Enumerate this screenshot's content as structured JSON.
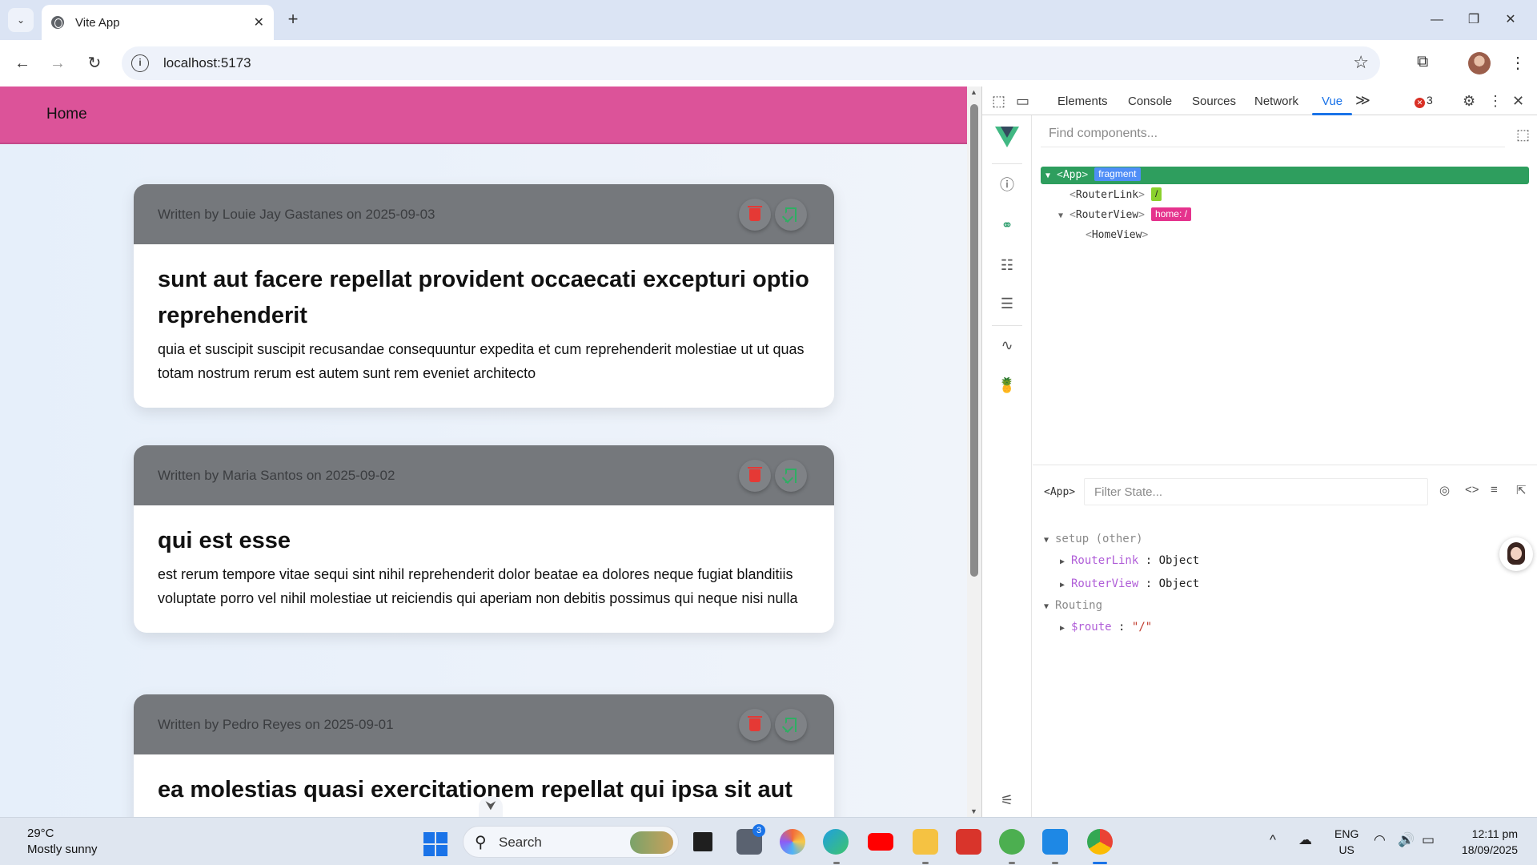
{
  "browser": {
    "tab_title": "Vite App",
    "tab_close": "✕",
    "new_tab": "+",
    "tab_search": "⌄",
    "window": {
      "minimize": "—",
      "maximize": "❐",
      "close": "✕"
    },
    "nav": {
      "back": "←",
      "forward": "→",
      "reload": "↻"
    },
    "site_info": "i",
    "url": "localhost:5173",
    "bookmark_star": "☆",
    "extensions": "⧉",
    "menu": "⋮"
  },
  "app": {
    "nav_home": "Home",
    "posts": [
      {
        "byline": "Written by Louie Jay Gastanes on 2025-09-03",
        "title": "sunt aut facere repellat provident occaecati excepturi optio reprehenderit",
        "body": "quia et suscipit suscipit recusandae consequuntur expedita et cum reprehenderit molestiae ut ut quas totam nostrum rerum est autem sunt rem eveniet architecto"
      },
      {
        "byline": "Written by Maria Santos on 2025-09-02",
        "title": "qui est esse",
        "body": "est rerum tempore vitae sequi sint nihil reprehenderit dolor beatae ea dolores neque fugiat blanditiis voluptate porro vel nihil molestiae ut reiciendis qui aperiam non debitis possimus qui neque nisi nulla"
      },
      {
        "byline": "Written by Pedro Reyes on 2025-09-01",
        "title": "ea molestias quasi exercitationem repellat qui ipsa sit aut",
        "body": ""
      }
    ],
    "scroll_hint": "⮟"
  },
  "devtools": {
    "tabs": [
      "Elements",
      "Console",
      "Sources",
      "Network",
      "Vue"
    ],
    "active_tab": "Vue",
    "more_tabs": "≫",
    "error_count": "3",
    "error_icon": "✕",
    "settings": "⚙",
    "menu": "⋮",
    "close": "✕",
    "inspect_icon": "⬚",
    "device_icon": "▭",
    "rail": {
      "info": "ⓘ",
      "components": "⚭",
      "tree": "☷",
      "timeline": "☰",
      "routes": "∿",
      "pinia": "🍍",
      "settings": "⚟"
    },
    "find_placeholder": "Find components...",
    "select_tool": "⬚",
    "tree": {
      "app": "App",
      "app_chip": "fragment",
      "router_link": "RouterLink",
      "router_link_chip": "/",
      "router_view": "RouterView",
      "router_view_chip": "home: /",
      "home_view": "HomeView",
      "lt": "<",
      "gt": ">"
    },
    "state": {
      "component_name": "<App>",
      "filter_placeholder": "Filter State...",
      "tools": [
        "◎",
        "<>",
        "≡",
        "⇱"
      ],
      "setup_label": "setup (other)",
      "router_link_key": "RouterLink",
      "router_view_key": "RouterView",
      "object_label": "Object",
      "routing_label": "Routing",
      "route_key": "$route",
      "route_value": "\"/\"",
      "colon": ":"
    }
  },
  "taskbar": {
    "temperature": "29°C",
    "weather": "Mostly sunny",
    "search_label": "Search",
    "search_icon": "⚲",
    "files_badge": "3",
    "tray_chevron": "^",
    "lang_top": "ENG",
    "lang_bottom": "US",
    "time": "12:11 pm",
    "date": "18/09/2025"
  }
}
